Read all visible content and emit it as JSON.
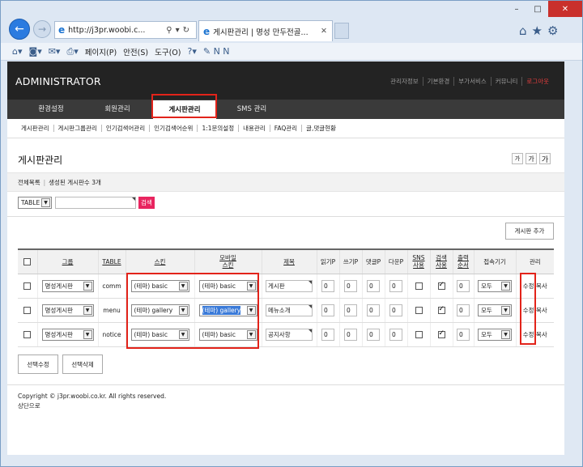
{
  "browser": {
    "address": "http://j3pr.woobi.c...",
    "tab_title": "게시판관리 | 명성 만두전골...",
    "window_controls": [
      "–",
      "□",
      "✕"
    ],
    "command_menu": [
      "페이지(P)",
      "안전(S)",
      "도구(O)"
    ]
  },
  "header": {
    "logo": "ADMINISTRATOR",
    "top_links": [
      "관리자정보",
      "기본환경",
      "부가서비스",
      "커뮤니티",
      "로그아웃"
    ]
  },
  "main_menu": [
    "환경설정",
    "회원관리",
    "게시판관리",
    "SMS 관리"
  ],
  "sub_menu": [
    "게시판관리",
    "게시판그룹관리",
    "인기검색어관리",
    "인기검색어순위",
    "1:1문의설정",
    "내용관리",
    "FAQ관리",
    "글,댓글현황"
  ],
  "page": {
    "title": "게시판관리",
    "font_buttons": [
      "가",
      "가",
      "가"
    ],
    "all_list": "전체목록",
    "count_text": "생성된 게시판수 3개",
    "search_select": "TABLE",
    "search_button": "검색",
    "add_button": "게시판 추가"
  },
  "table": {
    "headers": [
      "그룹",
      "TABLE",
      "스킨",
      "모바일\n스킨",
      "제목",
      "읽기P",
      "쓰기P",
      "댓글P",
      "다운P",
      "SNS\n사용",
      "검색\n사용",
      "출력\n순서",
      "접속기기",
      "관리"
    ],
    "rows": [
      {
        "group": "명성게시판",
        "table": "comm",
        "skin": "(테마) basic",
        "mobile_skin": "(테마) basic",
        "subject": "게시판",
        "read": "0",
        "write": "0",
        "comment": "0",
        "download": "0",
        "sns": false,
        "search": true,
        "order": "0",
        "device": "모두",
        "manage": "수정 복사"
      },
      {
        "group": "명성게시판",
        "table": "menu",
        "skin": "(테마) gallery",
        "mobile_skin": "(테마) gallery",
        "subject": "메뉴소개",
        "read": "0",
        "write": "0",
        "comment": "0",
        "download": "0",
        "sns": false,
        "search": true,
        "order": "0",
        "device": "모두",
        "manage": "수정 복사"
      },
      {
        "group": "명성게시판",
        "table": "notice",
        "skin": "(테마) basic",
        "mobile_skin": "(테마) basic",
        "subject": "공지사항",
        "read": "0",
        "write": "0",
        "comment": "0",
        "download": "0",
        "sns": false,
        "search": true,
        "order": "0",
        "device": "모두",
        "manage": "수정 복사"
      }
    ]
  },
  "buttons": {
    "edit_selected": "선택수정",
    "delete_selected": "선택삭제"
  },
  "footer": {
    "copyright": "Copyright © j3pr.woobi.co.kr. All rights reserved.",
    "top": "상단으로"
  }
}
